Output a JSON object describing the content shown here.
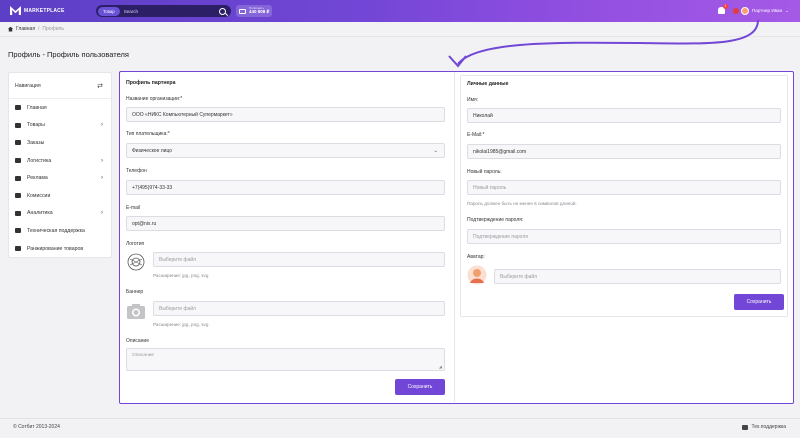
{
  "header": {
    "logo_text": "MARKETPLACE",
    "search_category": "Товар",
    "search_placeholder": "Search",
    "wallet_label": "Пополнить",
    "wallet_amount": "440 808 ₽",
    "notifications_count": "1",
    "user_name": "Партнер Иван"
  },
  "breadcrumb": {
    "home": "Главная",
    "separator": "/",
    "current": "Профиль"
  },
  "page_title": "Профиль - Профиль пользователя",
  "sidebar": {
    "title": "Навигация",
    "items": [
      {
        "label": "Главная",
        "icon": "home-icon",
        "has_children": false
      },
      {
        "label": "Товары",
        "icon": "box-icon",
        "has_children": true
      },
      {
        "label": "Заказы",
        "icon": "cart-icon",
        "has_children": false
      },
      {
        "label": "Логистика",
        "icon": "logistics-icon",
        "has_children": true
      },
      {
        "label": "Реклама",
        "icon": "megaphone-icon",
        "has_children": true
      },
      {
        "label": "Комиссии",
        "icon": "commission-icon",
        "has_children": false
      },
      {
        "label": "Аналитика",
        "icon": "chart-icon",
        "has_children": true
      },
      {
        "label": "Техническая поддержка",
        "icon": "support-icon",
        "has_children": false
      },
      {
        "label": "Ранжирование товаров",
        "icon": "ranking-icon",
        "has_children": false
      }
    ]
  },
  "partner": {
    "title": "Профиль партнера",
    "org_label": "Название организации:*",
    "org_value": "ООО «НИКС Компьютерный Супермаркет»",
    "payer_label": "Тип плательщика:*",
    "payer_value": "Физическое лицо",
    "phone_label": "Телефон",
    "phone_value": "+7(495)974-33-33",
    "email_label": "E-mail",
    "email_value": "opt@nix.ru",
    "logo_label": "Логотип",
    "logo_placeholder": "Выберите файл",
    "logo_hint": "Расширение: jpg, png, svg",
    "banner_label": "Баннер",
    "banner_placeholder": "Выберите файл",
    "banner_hint": "Расширение: jpg, png, svg",
    "description_label": "Описание",
    "description_placeholder": "Описание",
    "save_label": "Сохранить"
  },
  "personal": {
    "title": "Личные данные",
    "name_label": "Имя:",
    "name_value": "Николай",
    "email_label": "E-Mail:*",
    "email_value": "nikolai1985@gmail.com",
    "password_label": "Новый пароль:",
    "password_placeholder": "Новый пароль",
    "password_hint": "Пароль должен быть не менее 6 символов длиной.",
    "confirm_label": "Подтверждение пароля:",
    "confirm_placeholder": "Подтверждение пароля",
    "avatar_label": "Аватар:",
    "avatar_placeholder": "Выберите файл",
    "save_label": "Сохранить"
  },
  "footer": {
    "copyright": "© Сотбит 2013-2024",
    "support": "Тех.поддержка"
  },
  "colors": {
    "accent": "#7246d6",
    "header_start": "#5b3fc4",
    "header_end": "#a55ae6"
  }
}
